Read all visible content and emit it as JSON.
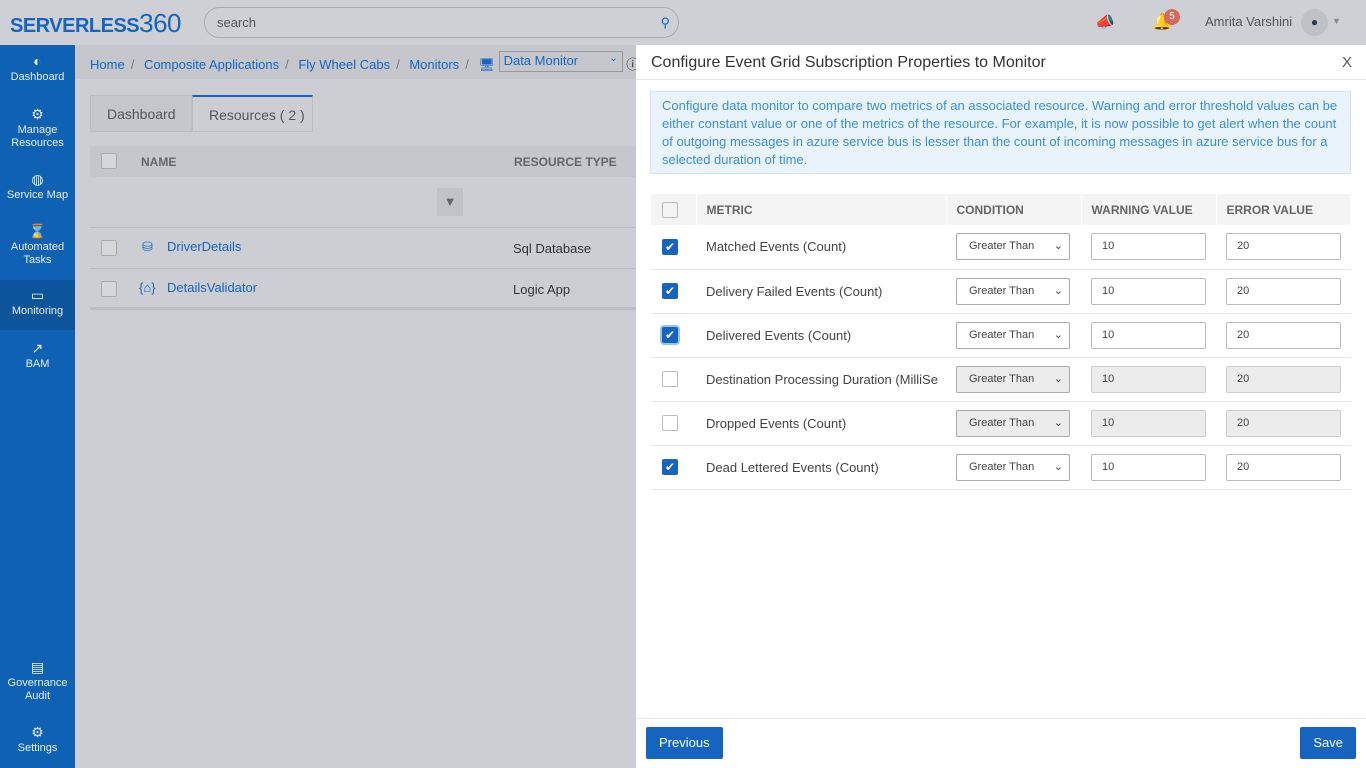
{
  "topbar": {
    "logo": "SERVERLESS",
    "logo_num": "360",
    "search_placeholder": "search",
    "notifications": "5",
    "user": "Amrita Varshini"
  },
  "sidebar": [
    {
      "label": "Dashboard",
      "icon": "gauge-icon"
    },
    {
      "label": "Manage Resources",
      "icon": "gear-icon"
    },
    {
      "label": "Service Map",
      "icon": "globe-icon"
    },
    {
      "label": "Automated Tasks",
      "icon": "hourglass-icon"
    },
    {
      "label": "Monitoring",
      "icon": "laptop-icon",
      "active": true
    },
    {
      "label": "BAM",
      "icon": "chart-line-icon"
    },
    {
      "label": "Governance Audit",
      "icon": "document-icon"
    },
    {
      "label": "Settings",
      "icon": "gear-icon"
    }
  ],
  "breadcrumb": [
    "Home",
    "Composite Applications",
    "Fly Wheel Cabs",
    "Monitors"
  ],
  "monitor_select": "Data Monitor",
  "tabs": [
    "Dashboard",
    "Resources ( 2 )"
  ],
  "resources": {
    "headers": [
      "NAME",
      "RESOURCE TYPE"
    ],
    "rows": [
      {
        "name": "DriverDetails",
        "type": "Sql Database"
      },
      {
        "name": "DetailsValidator",
        "type": "Logic App"
      }
    ]
  },
  "panel": {
    "title": "Configure Event Grid Subscription Properties to Monitor",
    "close": "X",
    "info": "Configure data monitor to compare two metrics of an associated resource. Warning and error threshold values can be either constant value or one of the metrics of the resource. For example, it is now possible to get alert when the count of outgoing messages in azure service bus is lesser than the count of incoming messages in azure service bus for a selected duration of time.",
    "headers": [
      "METRIC",
      "CONDITION",
      "WARNING VALUE",
      "ERROR VALUE"
    ],
    "rows": [
      {
        "checked": true,
        "metric": "Matched Events (Count)",
        "condition": "Greater Than",
        "warning": "10",
        "error": "20"
      },
      {
        "checked": true,
        "metric": "Delivery Failed Events (Count)",
        "condition": "Greater Than",
        "warning": "10",
        "error": "20"
      },
      {
        "checked": true,
        "metric": "Delivered Events (Count)",
        "condition": "Greater Than",
        "warning": "10",
        "error": "20"
      },
      {
        "checked": false,
        "metric": "Destination Processing Duration (MilliSe",
        "condition": "Greater Than",
        "warning": "10",
        "error": "20"
      },
      {
        "checked": false,
        "metric": "Dropped Events (Count)",
        "condition": "Greater Than",
        "warning": "10",
        "error": "20"
      },
      {
        "checked": true,
        "metric": "Dead Lettered Events (Count)",
        "condition": "Greater Than",
        "warning": "10",
        "error": "20"
      }
    ],
    "previous": "Previous",
    "save": "Save"
  }
}
